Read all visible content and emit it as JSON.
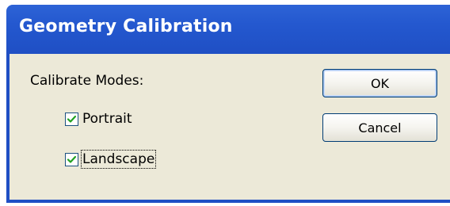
{
  "window": {
    "title": "Geometry Calibration"
  },
  "group": {
    "label": "Calibrate Modes:"
  },
  "options": [
    {
      "label": "Portrait",
      "checked": true
    },
    {
      "label": "Landscape",
      "checked": true
    }
  ],
  "buttons": {
    "ok_label": "OK",
    "cancel_label": "Cancel"
  },
  "colors": {
    "title_bar": "#2458cf",
    "client_background": "#ece9d8",
    "checkmark": "#21a121"
  },
  "icons": {
    "checkmark": "check-icon"
  }
}
